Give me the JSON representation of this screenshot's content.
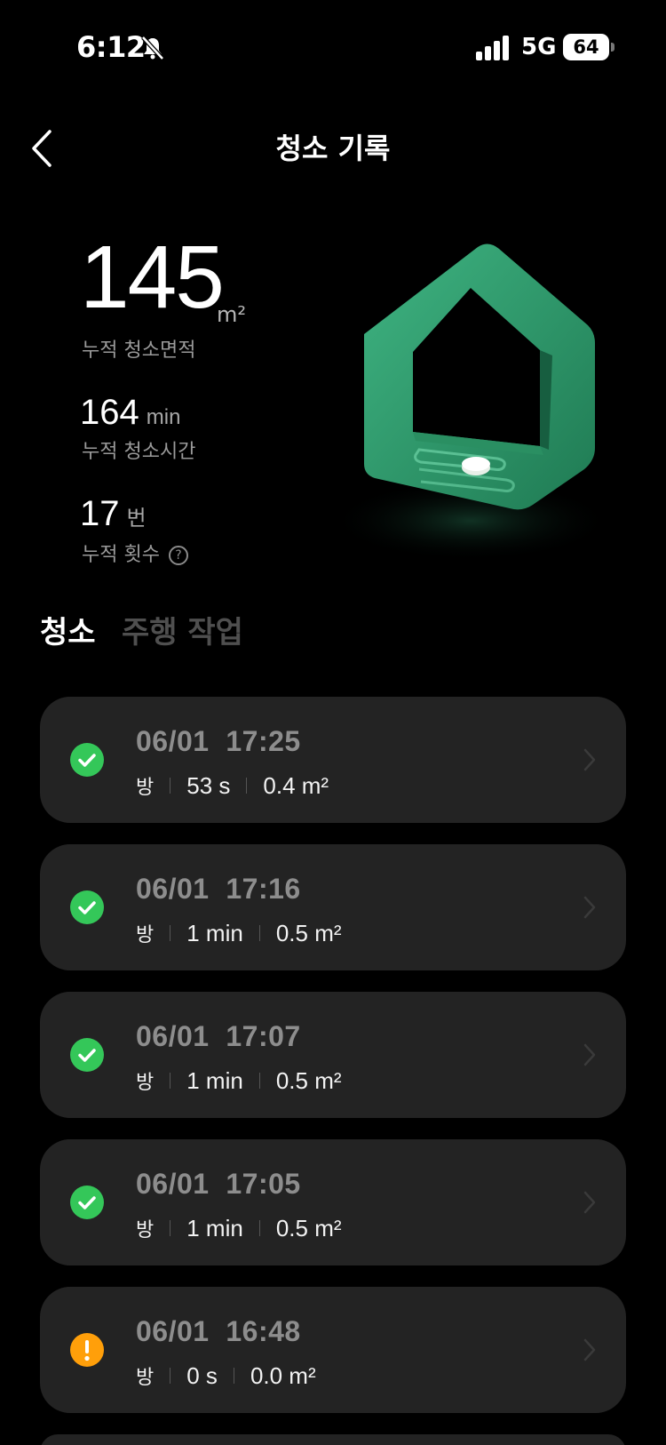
{
  "status_bar": {
    "time": "6:12",
    "network": "5G",
    "battery": "64"
  },
  "header": {
    "title": "청소 기록"
  },
  "stats": {
    "area_value": "145",
    "area_unit": "m²",
    "area_label": "누적 청소면적",
    "time_value": "164",
    "time_unit": "min",
    "time_label": "누적 청소시간",
    "count_value": "17",
    "count_unit": "번",
    "count_label": "누적 횟수"
  },
  "tabs": [
    {
      "label": "청소",
      "active": true
    },
    {
      "label": "주행 작업",
      "active": false
    }
  ],
  "records": [
    {
      "date": "06/01",
      "time": "17:25",
      "room": "방",
      "duration": "53 s",
      "area": "0.4 m²",
      "status": "success"
    },
    {
      "date": "06/01",
      "time": "17:16",
      "room": "방",
      "duration": "1 min",
      "area": "0.5 m²",
      "status": "success"
    },
    {
      "date": "06/01",
      "time": "17:07",
      "room": "방",
      "duration": "1 min",
      "area": "0.5 m²",
      "status": "success"
    },
    {
      "date": "06/01",
      "time": "17:05",
      "room": "방",
      "duration": "1 min",
      "area": "0.5 m²",
      "status": "success"
    },
    {
      "date": "06/01",
      "time": "16:48",
      "room": "방",
      "duration": "0 s",
      "area": "0.0 m²",
      "status": "warning"
    }
  ],
  "colors": {
    "success": "#34c759",
    "warning": "#ff9f0a",
    "card": "#232323",
    "illustration": "#2e9e6e"
  }
}
